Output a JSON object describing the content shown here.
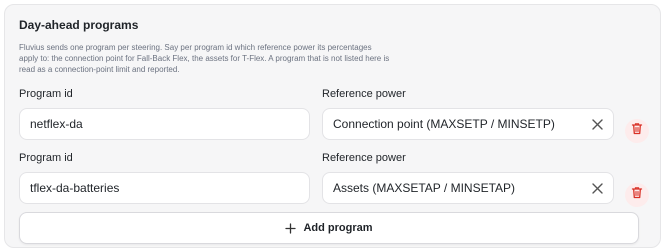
{
  "section": {
    "title": "Day-ahead programs",
    "description": "Fluvius sends one program per steering. Say per program id which reference power its percentages apply to: the connection point for Fall-Back Flex, the assets for T-Flex. A program that is not listed here is read as a connection-point limit and reported."
  },
  "programs": [
    {
      "id_label": "Program id",
      "id_value": "netflex-da",
      "ref_label": "Reference power",
      "ref_value": "Connection point (MAXSETP / MINSETP)"
    },
    {
      "id_label": "Program id",
      "id_value": "tflex-da-batteries",
      "ref_label": "Reference power",
      "ref_value": "Assets (MAXSETAP / MINSETAP)"
    }
  ],
  "add_button": {
    "label": "Add program",
    "icon": "plus-icon"
  },
  "icons": {
    "clear": "close-icon",
    "delete": "trash-icon"
  },
  "colors": {
    "danger": "#d93025",
    "danger_bg": "#fdecec",
    "panel_bg": "#f6f6f7"
  }
}
